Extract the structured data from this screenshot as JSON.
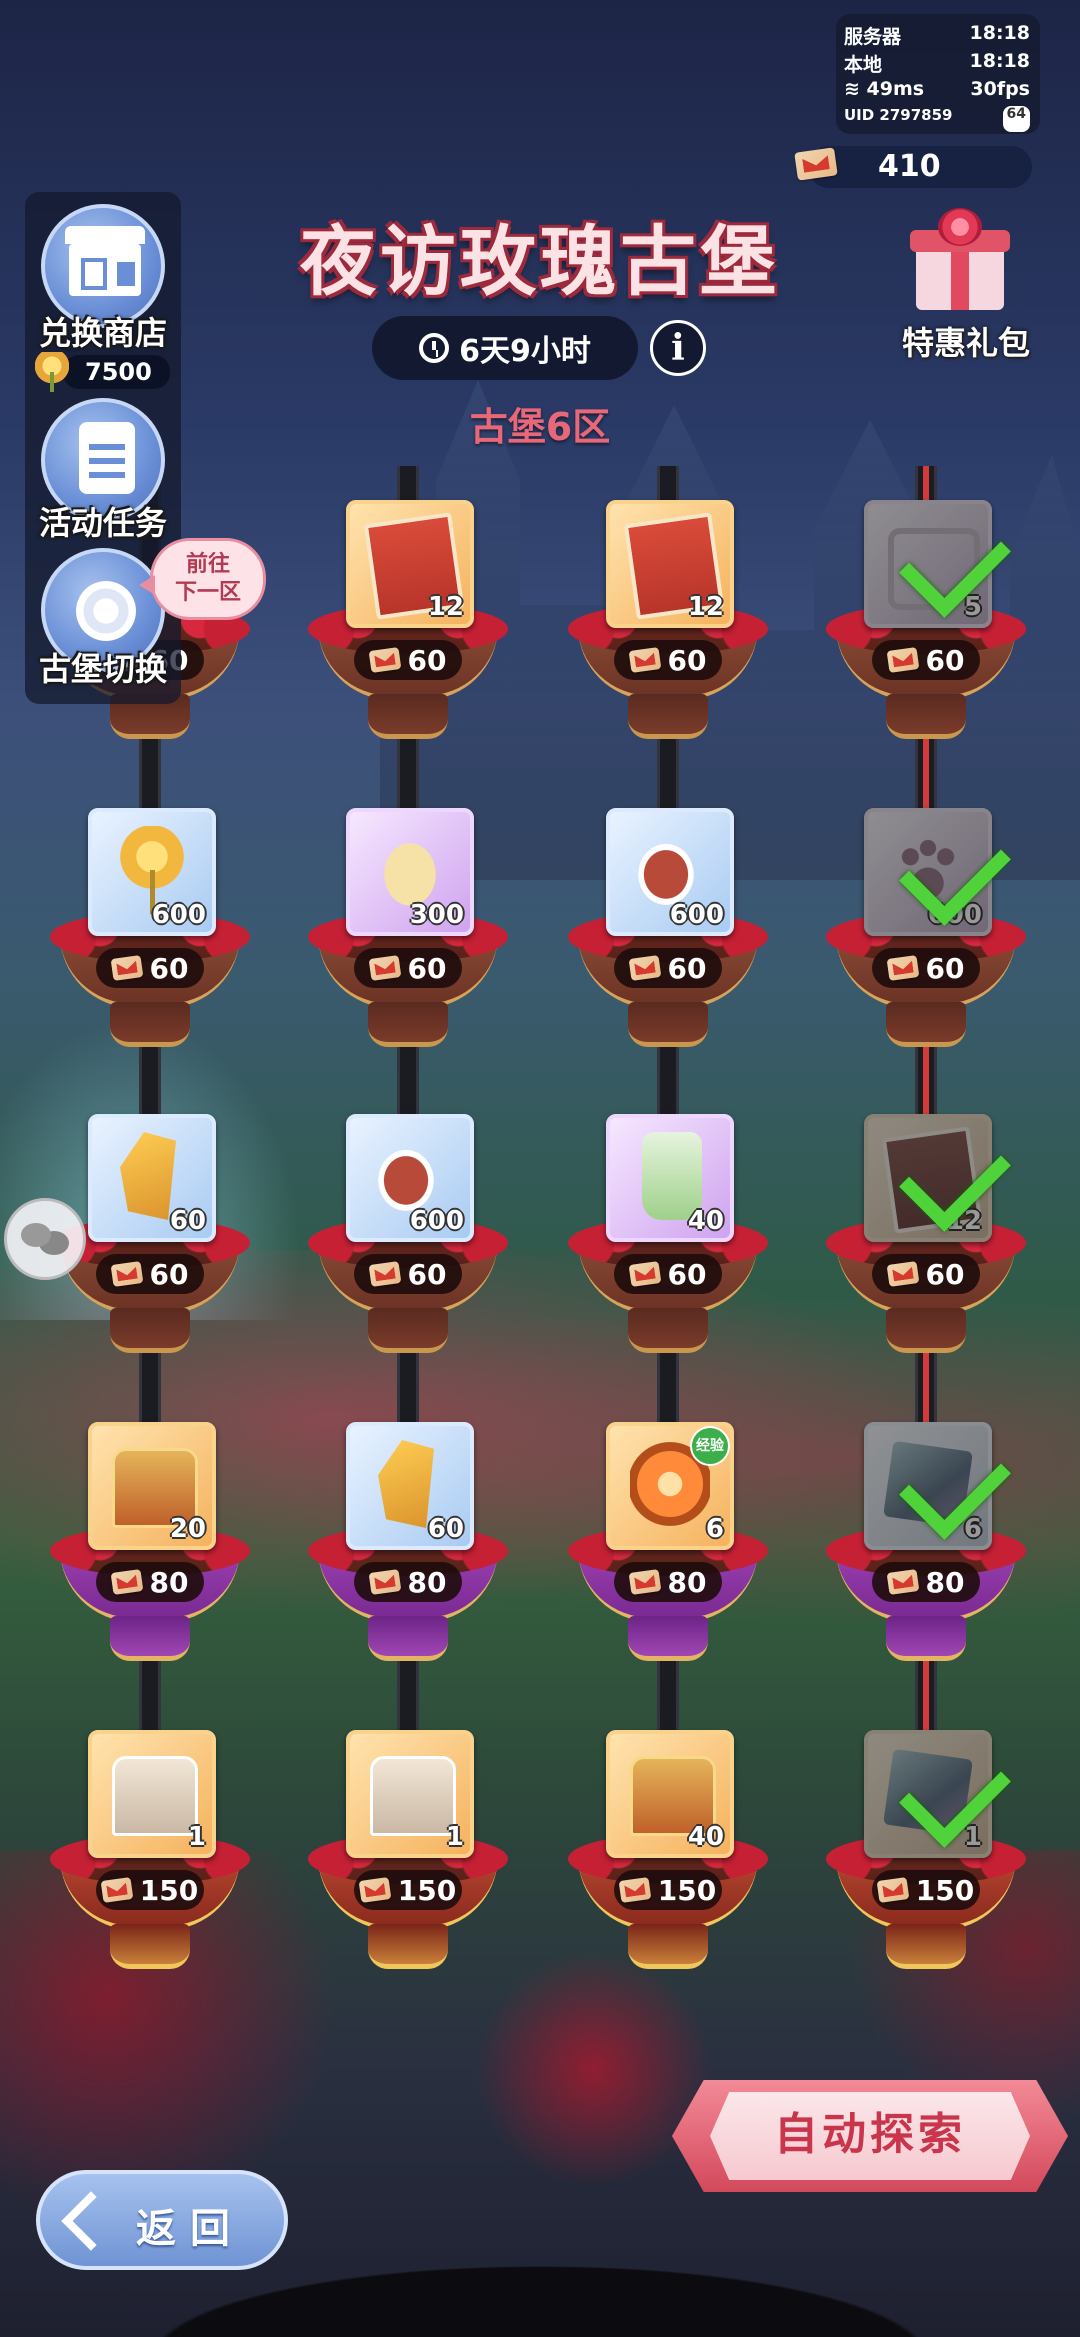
{
  "status": {
    "server_label": "服务器",
    "server_time": "18:18",
    "local_label": "本地",
    "local_time": "18:18",
    "ping": "49ms",
    "fps": "30fps",
    "uid": "UID 2797859",
    "uid_badge": "64"
  },
  "currency": {
    "value": "410"
  },
  "title": "夜访玫瑰古堡",
  "timer": "6天9小时",
  "info": "i",
  "zone": "古堡6区",
  "gift": {
    "label": "特惠礼包"
  },
  "menu": {
    "shop": {
      "label": "兑换商店",
      "rose_count": "7500"
    },
    "tasks": {
      "label": "活动任务"
    },
    "switch": {
      "label": "古堡切换"
    },
    "bubble_line1": "前往",
    "bubble_line2": "下一区"
  },
  "grid": {
    "rows": [
      {
        "cost": "60",
        "bowl": "brown",
        "cells": [
          {
            "item": "hidden",
            "qty": "",
            "frame": "purple",
            "claimed": false
          },
          {
            "item": "tarot-card",
            "qty": "12",
            "frame": "orange",
            "claimed": false
          },
          {
            "item": "tarot-card",
            "qty": "12",
            "frame": "orange",
            "claimed": false
          },
          {
            "item": "cat-frame",
            "qty": "5",
            "frame": "purple",
            "claimed": true
          }
        ]
      },
      {
        "cost": "60",
        "bowl": "brown",
        "cells": [
          {
            "item": "golden-rose",
            "qty": "600",
            "frame": "blue",
            "claimed": false
          },
          {
            "item": "biscuit",
            "qty": "300",
            "frame": "purple",
            "claimed": false
          },
          {
            "item": "meat",
            "qty": "600",
            "frame": "blue",
            "claimed": false
          },
          {
            "item": "paw",
            "qty": "600",
            "frame": "purple",
            "claimed": true
          }
        ]
      },
      {
        "cost": "60",
        "bowl": "brown",
        "cells": [
          {
            "item": "amber",
            "qty": "60",
            "frame": "blue",
            "claimed": false
          },
          {
            "item": "meat",
            "qty": "600",
            "frame": "blue",
            "claimed": false
          },
          {
            "item": "potion-bottle",
            "qty": "40",
            "frame": "purple",
            "claimed": false
          },
          {
            "item": "tarot-card",
            "qty": "12",
            "frame": "orange",
            "claimed": true
          }
        ]
      },
      {
        "cost": "80",
        "bowl": "purple",
        "cells": [
          {
            "item": "treasure-chest",
            "qty": "20",
            "frame": "orange",
            "claimed": false
          },
          {
            "item": "amber",
            "qty": "60",
            "frame": "blue",
            "claimed": false
          },
          {
            "item": "exp-orb",
            "qty": "6",
            "frame": "orange",
            "claimed": false,
            "badge": "经验"
          },
          {
            "item": "crystal-cube",
            "qty": "6",
            "frame": "blue",
            "claimed": true
          }
        ]
      },
      {
        "cost": "150",
        "bowl": "gold",
        "cells": [
          {
            "item": "silver-chest",
            "qty": "1",
            "frame": "orange",
            "claimed": false
          },
          {
            "item": "silver-chest",
            "qty": "1",
            "frame": "orange",
            "claimed": false
          },
          {
            "item": "treasure-chest",
            "qty": "40",
            "frame": "orange",
            "claimed": false
          },
          {
            "item": "cube-frame",
            "qty": "1",
            "frame": "orange",
            "claimed": true
          }
        ]
      }
    ]
  },
  "auto_explore": "自动探索",
  "back": "返回",
  "colors": {
    "title": "#fbe2e4",
    "zone": "#e8687a",
    "accent": "#d3495c",
    "check": "#4fd23a"
  }
}
